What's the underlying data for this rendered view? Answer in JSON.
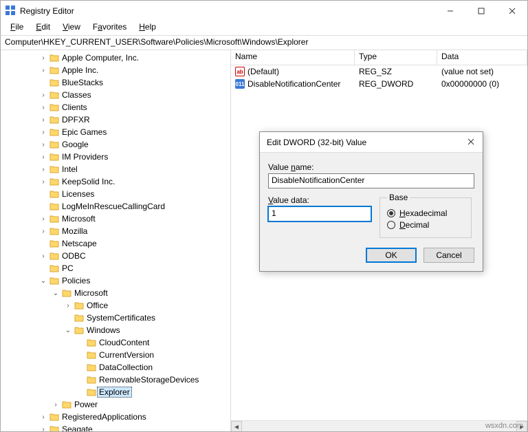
{
  "window": {
    "title": "Registry Editor"
  },
  "menu": {
    "file": "File",
    "edit": "Edit",
    "view": "View",
    "favorites": "Favorites",
    "help": "Help"
  },
  "address": "Computer\\HKEY_CURRENT_USER\\Software\\Policies\\Microsoft\\Windows\\Explorer",
  "columns": {
    "name": "Name",
    "type": "Type",
    "data": "Data"
  },
  "values": [
    {
      "icon": "ab",
      "name": "(Default)",
      "type": "REG_SZ",
      "data": "(value not set)"
    },
    {
      "icon": "dw",
      "name": "DisableNotificationCenter",
      "type": "REG_DWORD",
      "data": "0x00000000 (0)"
    }
  ],
  "tree": [
    {
      "d": 3,
      "tw": ">",
      "n": "Apple Computer, Inc."
    },
    {
      "d": 3,
      "tw": ">",
      "n": "Apple Inc."
    },
    {
      "d": 3,
      "tw": "",
      "n": "BlueStacks"
    },
    {
      "d": 3,
      "tw": ">",
      "n": "Classes"
    },
    {
      "d": 3,
      "tw": ">",
      "n": "Clients"
    },
    {
      "d": 3,
      "tw": ">",
      "n": "DPFXR"
    },
    {
      "d": 3,
      "tw": ">",
      "n": "Epic Games"
    },
    {
      "d": 3,
      "tw": ">",
      "n": "Google"
    },
    {
      "d": 3,
      "tw": ">",
      "n": "IM Providers"
    },
    {
      "d": 3,
      "tw": ">",
      "n": "Intel"
    },
    {
      "d": 3,
      "tw": ">",
      "n": "KeepSolid Inc."
    },
    {
      "d": 3,
      "tw": "",
      "n": "Licenses"
    },
    {
      "d": 3,
      "tw": "",
      "n": "LogMeInRescueCallingCard"
    },
    {
      "d": 3,
      "tw": ">",
      "n": "Microsoft"
    },
    {
      "d": 3,
      "tw": ">",
      "n": "Mozilla"
    },
    {
      "d": 3,
      "tw": "",
      "n": "Netscape"
    },
    {
      "d": 3,
      "tw": ">",
      "n": "ODBC"
    },
    {
      "d": 3,
      "tw": "",
      "n": "PC"
    },
    {
      "d": 3,
      "tw": "v",
      "n": "Policies"
    },
    {
      "d": 4,
      "tw": "v",
      "n": "Microsoft"
    },
    {
      "d": 5,
      "tw": ">",
      "n": "Office"
    },
    {
      "d": 5,
      "tw": "",
      "n": "SystemCertificates"
    },
    {
      "d": 5,
      "tw": "v",
      "n": "Windows"
    },
    {
      "d": 6,
      "tw": "",
      "n": "CloudContent"
    },
    {
      "d": 6,
      "tw": "",
      "n": "CurrentVersion"
    },
    {
      "d": 6,
      "tw": "",
      "n": "DataCollection"
    },
    {
      "d": 6,
      "tw": "",
      "n": "RemovableStorageDevices"
    },
    {
      "d": 6,
      "tw": "",
      "n": "Explorer",
      "sel": true
    },
    {
      "d": 4,
      "tw": ">",
      "n": "Power"
    },
    {
      "d": 3,
      "tw": ">",
      "n": "RegisteredApplications"
    },
    {
      "d": 3,
      "tw": ">",
      "n": "Seagate"
    }
  ],
  "dialog": {
    "title": "Edit DWORD (32-bit) Value",
    "value_name_label": "Value name:",
    "value_name": "DisableNotificationCenter",
    "value_data_label": "Value data:",
    "value_data": "1",
    "base_label": "Base",
    "hex": "Hexadecimal",
    "dec": "Decimal",
    "ok": "OK",
    "cancel": "Cancel"
  },
  "watermark": "wsxdn.com"
}
